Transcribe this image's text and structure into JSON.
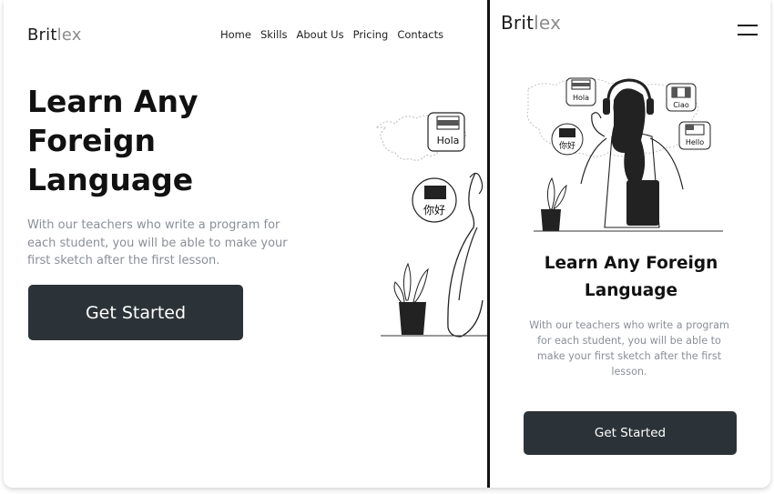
{
  "desktop": {
    "logo": {
      "main": "Brit",
      "accent": "lex"
    },
    "nav": [
      "Home",
      "Skills",
      "About Us",
      "Pricing",
      "Contacts"
    ],
    "hero_title": "Learn Any Foreign Language",
    "hero_subtitle": "With our teachers who write a program for each student, you will be able to make your first sketch after the first lesson.",
    "cta_label": "Get Started",
    "bubbles": [
      "Hola",
      "你好"
    ]
  },
  "mobile": {
    "logo": {
      "main": "Brit",
      "accent": "lex"
    },
    "hero_title": "Learn Any Foreign Language",
    "hero_subtitle": "With our teachers who write a program for each student, you will be able to make your first sketch after the first lesson.",
    "cta_label": "Get Started",
    "bubbles": [
      "Hola",
      "Ciao",
      "你好",
      "Hello"
    ]
  },
  "colors": {
    "button": "#2b3338",
    "text_muted": "#8a8f97",
    "logo_accent": "#8c8c8c"
  },
  "icons": [
    "hamburger-menu-icon",
    "world-map-illustration",
    "headphones-woman-illustration",
    "plant-illustration"
  ]
}
